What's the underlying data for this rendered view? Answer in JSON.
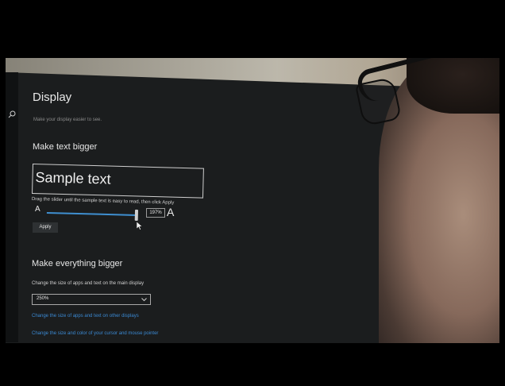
{
  "display": {
    "title": "Display",
    "subtitle": "Make your display easier to see.",
    "text_bigger": {
      "heading": "Make text bigger",
      "sample": "Sample text",
      "instruction": "Drag the slider until the sample text is easy to read, then click Apply",
      "slider_min_glyph": "A",
      "slider_max_glyph": "A",
      "slider_value_text": "197%",
      "slider_fraction": 0.97,
      "apply_label": "Apply"
    },
    "everything_bigger": {
      "heading": "Make everything bigger",
      "scale_label": "Change the size of apps and text on the main display",
      "scale_value": "250%"
    },
    "links": [
      "Change the size of apps and text on other displays",
      "Change the size and color of your cursor and mouse pointer"
    ]
  },
  "colors": {
    "accent": "#3b8ad4",
    "window_bg": "#1b1d1e",
    "text": "#e6e6e6"
  },
  "icons": {
    "search": "search-icon",
    "dropdown": "chevron-down-icon",
    "pointer": "mouse-pointer-icon"
  }
}
